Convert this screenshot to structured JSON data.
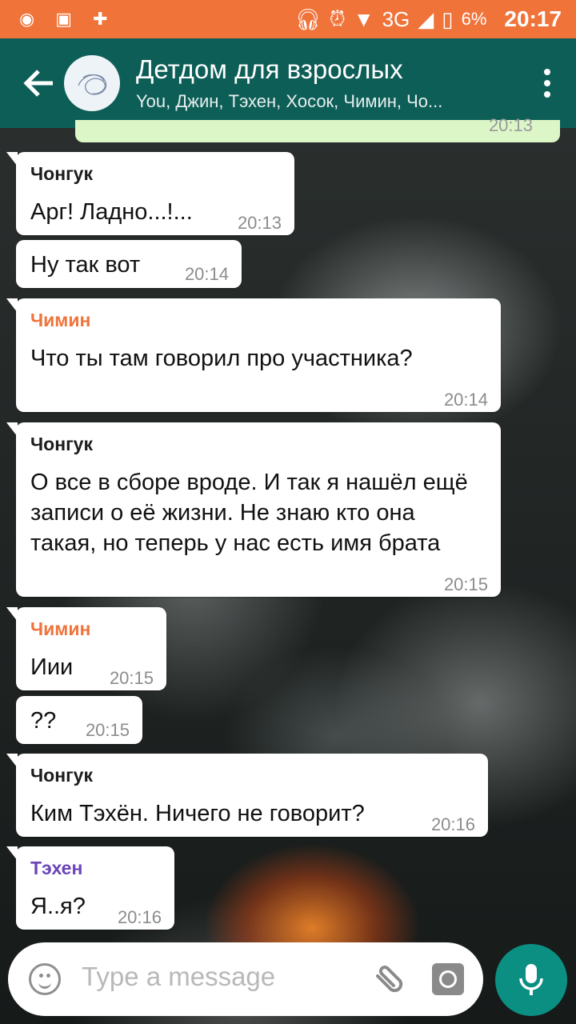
{
  "status_bar": {
    "network": "3G",
    "battery": "6%",
    "time": "20:17"
  },
  "header": {
    "title": "Детдом для взрослых",
    "subtitle": "You, Джин, Тэхен, Хосок, Чимин, Чо..."
  },
  "previous_message": {
    "time": "20:13"
  },
  "messages": [
    {
      "sender": "Чонгук",
      "sender_color": "#1c1c1c",
      "text": "Арг! Ладно...!...",
      "time": "20:13"
    },
    {
      "sender": "",
      "text": "Ну так вот",
      "time": "20:14"
    },
    {
      "sender": "Чимин",
      "sender_color": "#f0733a",
      "text": "Что ты там говорил про участника?",
      "time": "20:14"
    },
    {
      "sender": "Чонгук",
      "sender_color": "#1c1c1c",
      "text": "О все в сборе вроде. И так я нашёл ещё записи о её жизни. Не знаю кто она такая, но теперь у нас есть имя брата",
      "time": "20:15"
    },
    {
      "sender": "Чимин",
      "sender_color": "#f0733a",
      "text": "Иии",
      "time": "20:15"
    },
    {
      "sender": "",
      "text": "??",
      "time": "20:15"
    },
    {
      "sender": "Чонгук",
      "sender_color": "#1c1c1c",
      "text": "Ким Тэхён. Ничего не говорит?",
      "time": "20:16"
    },
    {
      "sender": "Тэхен",
      "sender_color": "#6b45b8",
      "text": "Я..я?",
      "time": "20:16"
    }
  ],
  "input": {
    "placeholder": "Type a message"
  },
  "icons": {
    "back": "arrow-back-icon",
    "menu": "more-vert-icon",
    "emoji": "emoji-icon",
    "attach": "paperclip-icon",
    "camera": "camera-icon",
    "mic": "mic-icon"
  },
  "colors": {
    "status_bar": "#f0733a",
    "app_bar": "#0d5e57",
    "mic_button": "#0b8f83",
    "outgoing_bubble": "#dcf6c8"
  }
}
